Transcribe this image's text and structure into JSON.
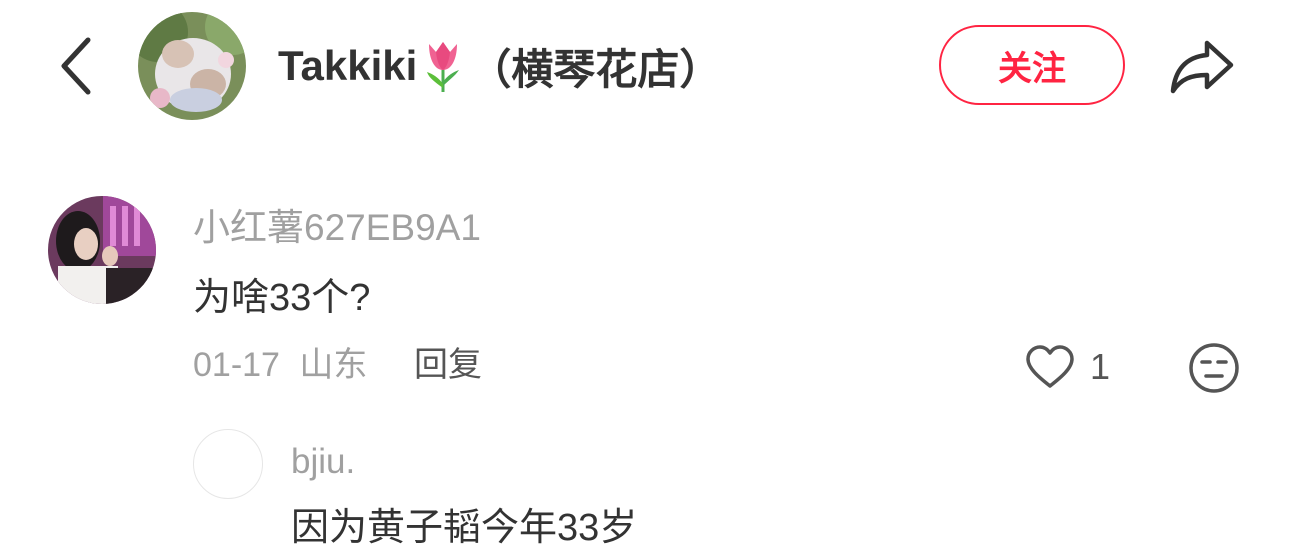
{
  "header": {
    "title_name": "Takkiki",
    "title_suffix": "（横琴花店）",
    "title_emoji_icon": "tulip-icon",
    "follow_label": "关注",
    "back_icon": "chevron-left-icon",
    "share_icon": "share-arrow-icon",
    "accent_color": "#ff2442"
  },
  "comment": {
    "username": "小红薯627EB9A1",
    "text": "为啥33个?",
    "date": "01-17",
    "location": "山东",
    "reply_label": "回复",
    "likes": "1",
    "like_icon": "heart-outline-icon",
    "emoji_icon": "emoji-face-icon"
  },
  "reply": {
    "username": "bjiu.",
    "text": "因为黄子韬今年33岁"
  }
}
